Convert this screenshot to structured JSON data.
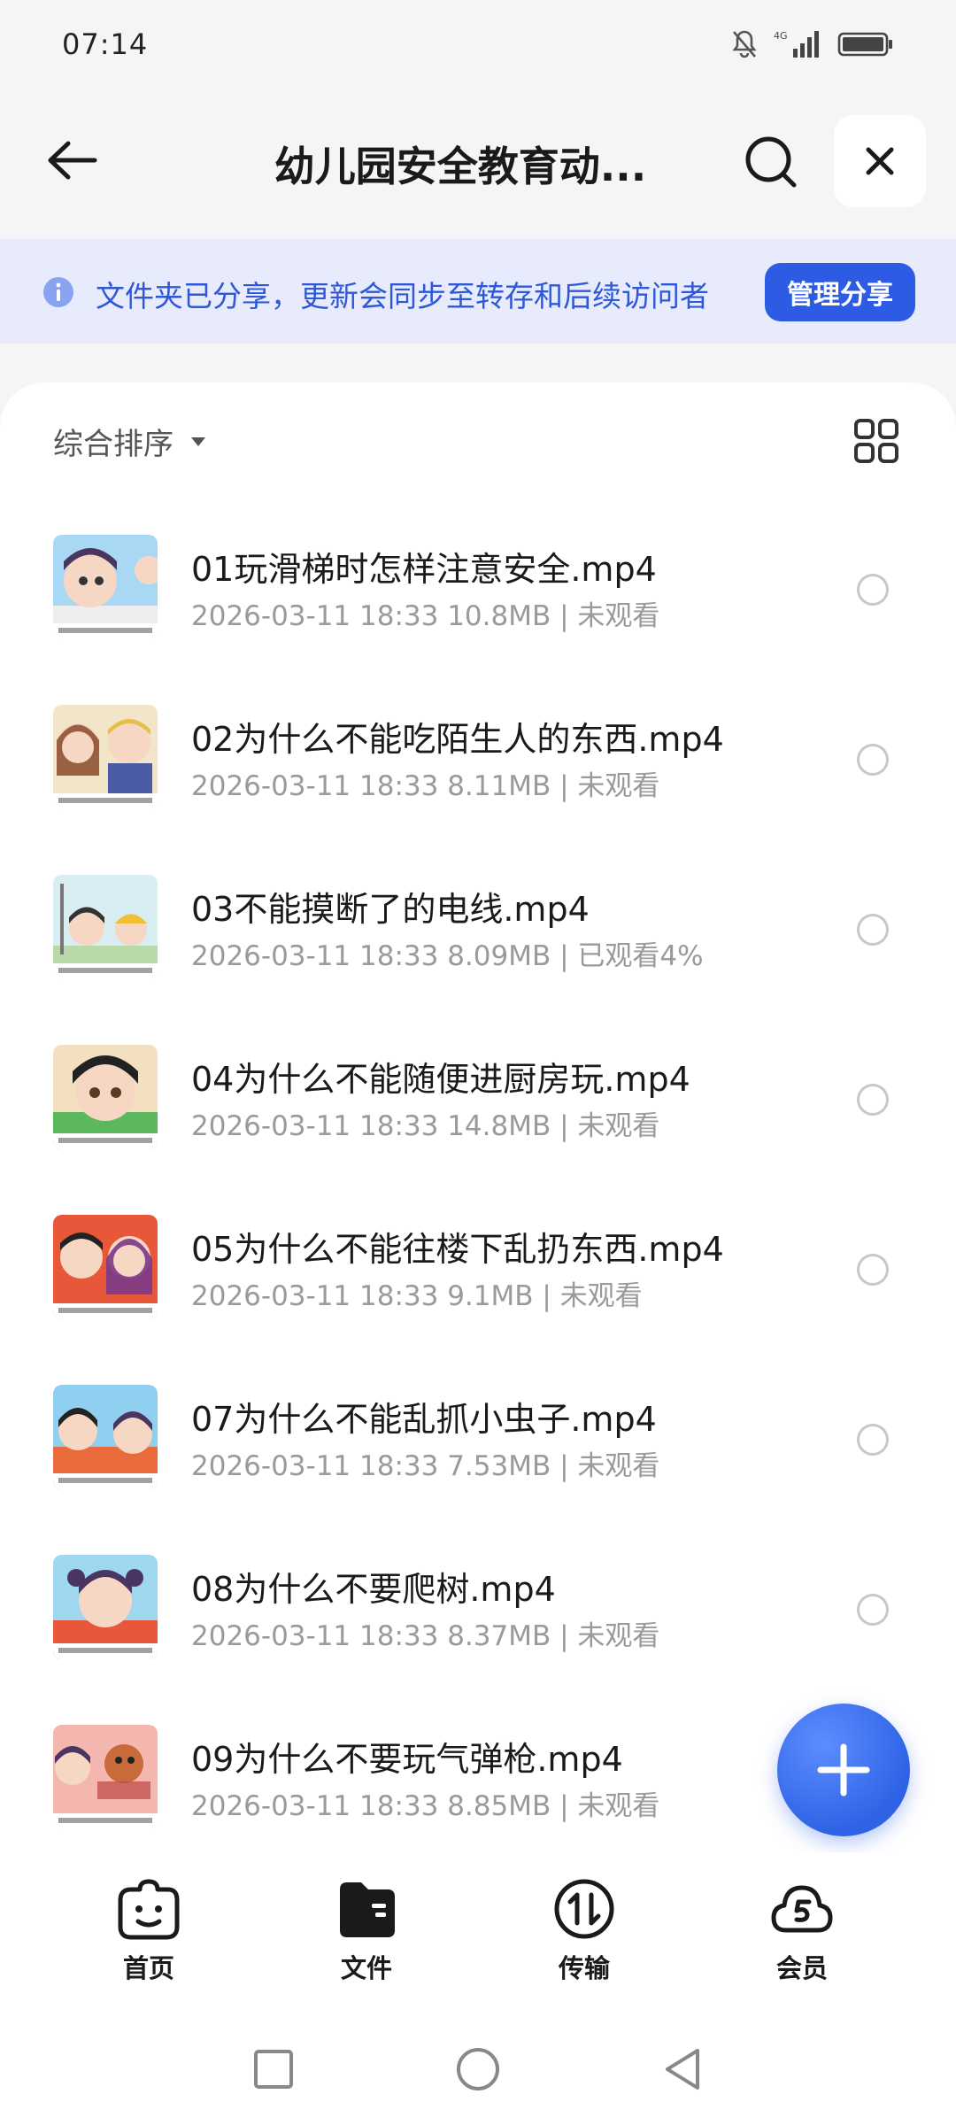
{
  "status_bar": {
    "time": "07:14"
  },
  "header": {
    "title": "幼儿园安全教育动..."
  },
  "share_banner": {
    "text": "文件夹已分享，更新会同步至转存和后续访问者",
    "button_label": "管理分享"
  },
  "sort": {
    "label": "综合排序"
  },
  "files": [
    {
      "name": "01玩滑梯时怎样注意安全.mp4",
      "meta": "2026-03-11 18:33  10.8MB | 未观看"
    },
    {
      "name": "02为什么不能吃陌生人的东西.mp4",
      "meta": "2026-03-11 18:33  8.11MB | 未观看"
    },
    {
      "name": "03不能摸断了的电线.mp4",
      "meta": "2026-03-11 18:33  8.09MB | 已观看4%"
    },
    {
      "name": "04为什么不能随便进厨房玩.mp4",
      "meta": "2026-03-11 18:33  14.8MB | 未观看"
    },
    {
      "name": "05为什么不能往楼下乱扔东西.mp4",
      "meta": "2026-03-11 18:33  9.1MB | 未观看"
    },
    {
      "name": "07为什么不能乱抓小虫子.mp4",
      "meta": "2026-03-11 18:33  7.53MB | 未观看"
    },
    {
      "name": "08为什么不要爬树.mp4",
      "meta": "2026-03-11 18:33  8.37MB | 未观看"
    },
    {
      "name": "09为什么不要玩气弹枪.mp4",
      "meta": "2026-03-11 18:33  8.85MB | 未观看"
    }
  ],
  "bottom_nav": [
    {
      "label": "首页",
      "icon": "home-face-icon"
    },
    {
      "label": "文件",
      "icon": "folder-icon"
    },
    {
      "label": "传输",
      "icon": "transfer-icon"
    },
    {
      "label": "会员",
      "icon": "cloud-vip-icon"
    }
  ],
  "colors": {
    "accent": "#2d5be3",
    "banner_bg": "#e7ebfb",
    "banner_text": "#2f58d9"
  }
}
